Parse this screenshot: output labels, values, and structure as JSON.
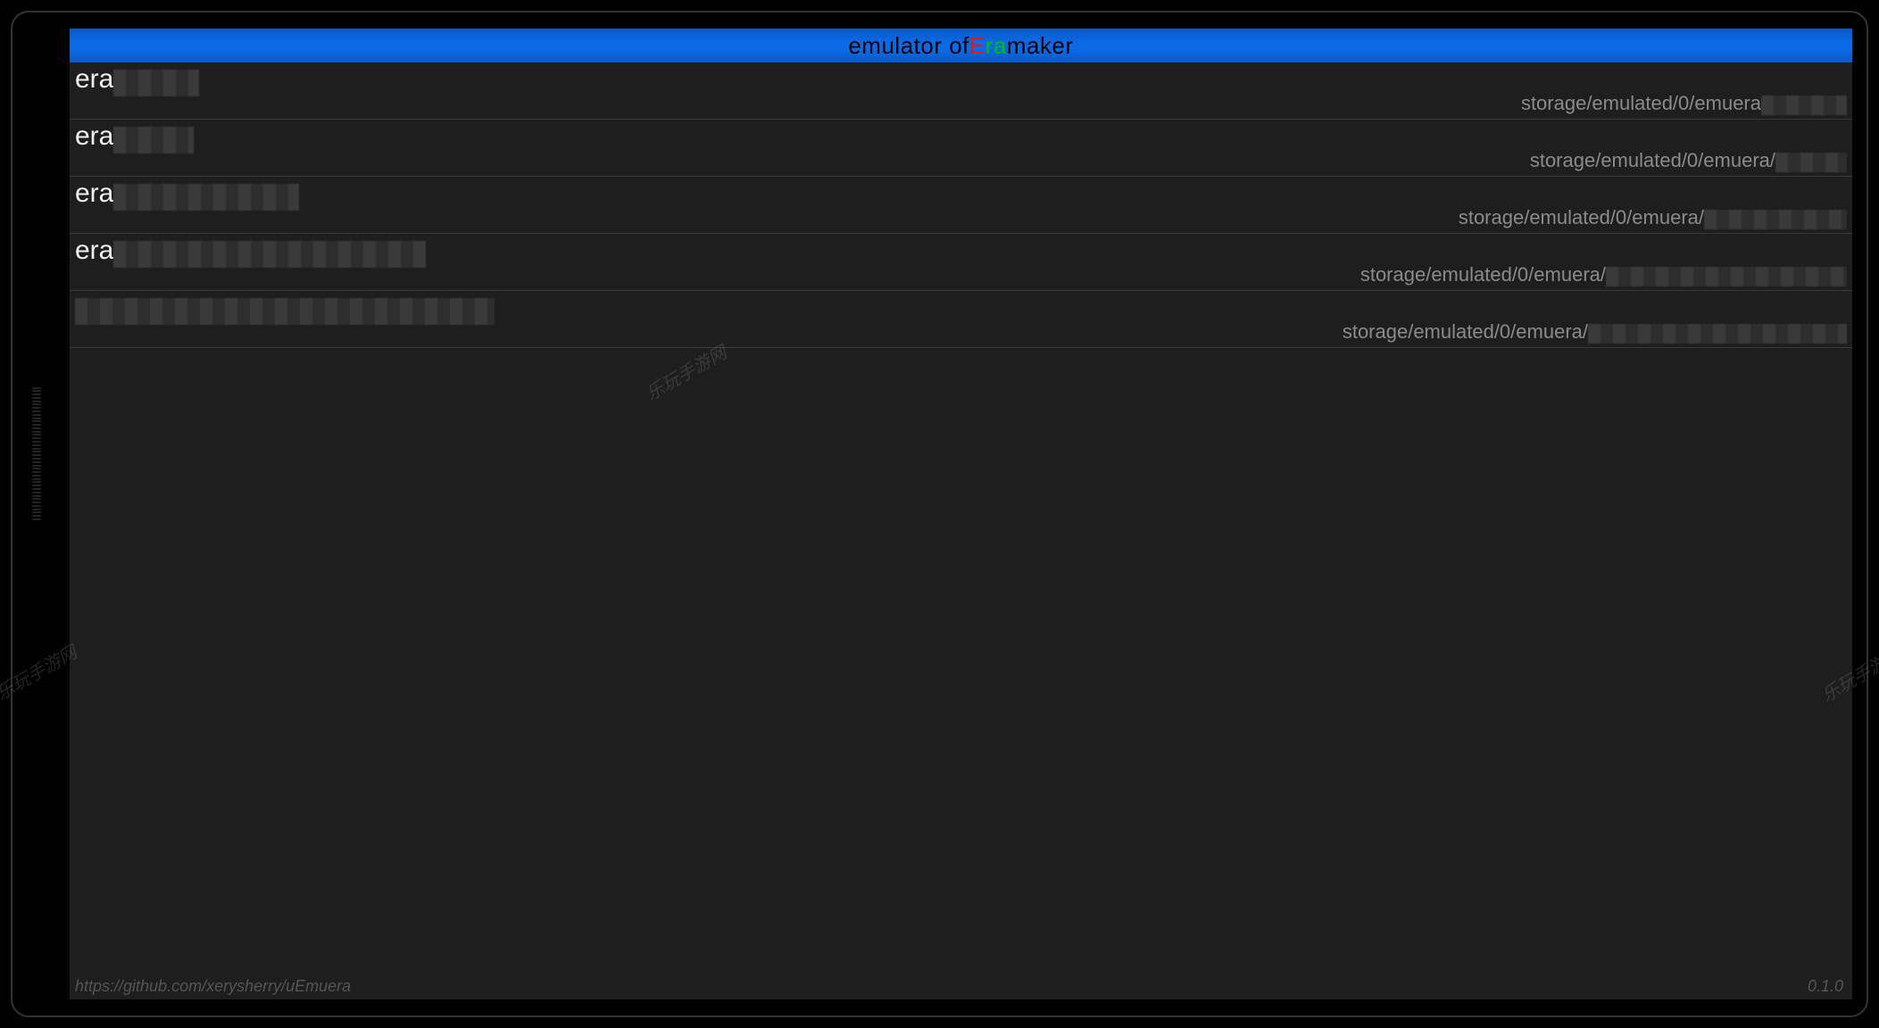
{
  "title": {
    "prefix": "emulator of ",
    "E": "E",
    "ra": "ra",
    "suffix": "maker"
  },
  "rows": [
    {
      "title_prefix": "era",
      "title_blur_w": 96,
      "path_prefix": "storage/emulated/0/emuera",
      "path_blur_w": 96
    },
    {
      "title_prefix": "era",
      "title_blur_w": 90,
      "path_prefix": "storage/emulated/0/emuera/",
      "path_blur_w": 80
    },
    {
      "title_prefix": "era",
      "title_blur_w": 208,
      "path_prefix": "storage/emulated/0/emuera/",
      "path_blur_w": 160
    },
    {
      "title_prefix": "era",
      "title_blur_w": 350,
      "path_prefix": "storage/emulated/0/emuera/",
      "path_blur_w": 270
    },
    {
      "title_prefix": "",
      "title_blur_w": 470,
      "path_prefix": "storage/emulated/0/emuera/",
      "path_blur_w": 290
    }
  ],
  "footer": {
    "url": "https://github.com/xerysherry/uEmuera",
    "version": "0.1.0"
  },
  "watermark_text": "乐玩手游网"
}
